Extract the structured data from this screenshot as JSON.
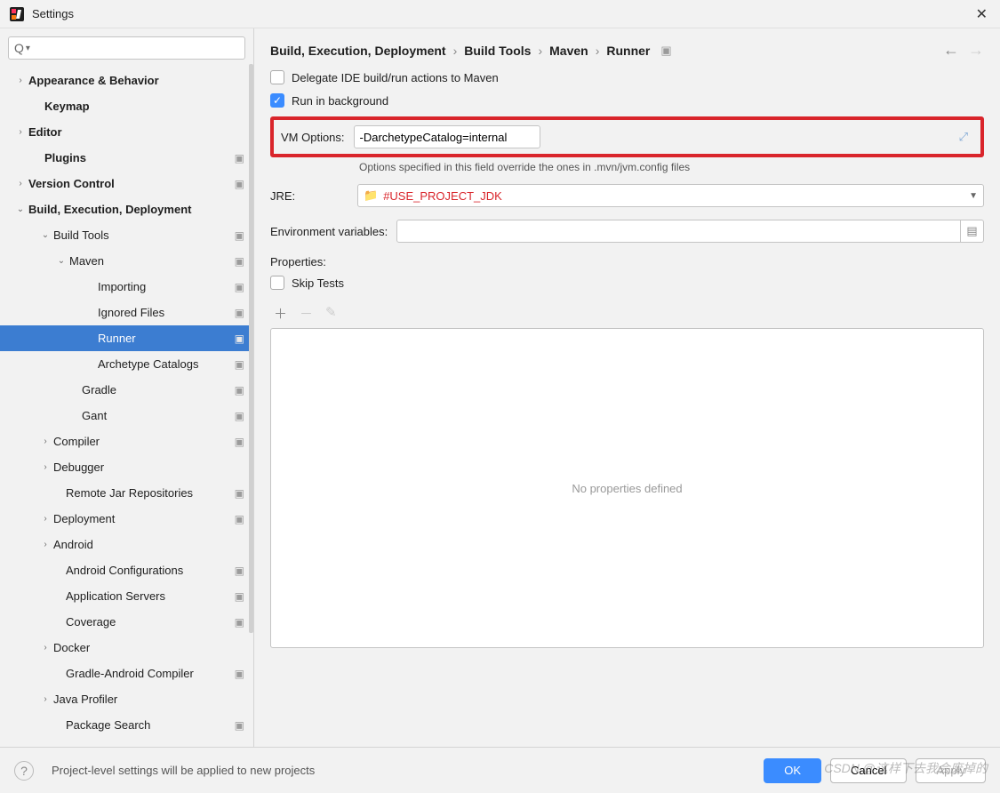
{
  "window": {
    "title": "Settings"
  },
  "sidebar": {
    "search_placeholder": "",
    "items": [
      {
        "label": "Appearance & Behavior",
        "indent": 14,
        "chev": "›",
        "bold": true
      },
      {
        "label": "Keymap",
        "indent": 32,
        "bold": true
      },
      {
        "label": "Editor",
        "indent": 14,
        "chev": "›",
        "bold": true
      },
      {
        "label": "Plugins",
        "indent": 32,
        "bold": true,
        "badge": "▣"
      },
      {
        "label": "Version Control",
        "indent": 14,
        "chev": "›",
        "bold": true,
        "badge": "▣"
      },
      {
        "label": "Build, Execution, Deployment",
        "indent": 14,
        "chev": "⌄",
        "bold": true
      },
      {
        "label": "Build Tools",
        "indent": 42,
        "chev": "⌄",
        "badge": "▣"
      },
      {
        "label": "Maven",
        "indent": 60,
        "chev": "⌄",
        "badge": "▣"
      },
      {
        "label": "Importing",
        "indent": 92,
        "badge": "▣"
      },
      {
        "label": "Ignored Files",
        "indent": 92,
        "badge": "▣"
      },
      {
        "label": "Runner",
        "indent": 92,
        "badge": "▣",
        "selected": true
      },
      {
        "label": "Archetype Catalogs",
        "indent": 92,
        "badge": "▣"
      },
      {
        "label": "Gradle",
        "indent": 74,
        "badge": "▣"
      },
      {
        "label": "Gant",
        "indent": 74,
        "badge": "▣"
      },
      {
        "label": "Compiler",
        "indent": 42,
        "chev": "›",
        "badge": "▣"
      },
      {
        "label": "Debugger",
        "indent": 42,
        "chev": "›"
      },
      {
        "label": "Remote Jar Repositories",
        "indent": 56,
        "badge": "▣"
      },
      {
        "label": "Deployment",
        "indent": 42,
        "chev": "›",
        "badge": "▣"
      },
      {
        "label": "Android",
        "indent": 42,
        "chev": "›"
      },
      {
        "label": "Android Configurations",
        "indent": 56,
        "badge": "▣"
      },
      {
        "label": "Application Servers",
        "indent": 56,
        "badge": "▣"
      },
      {
        "label": "Coverage",
        "indent": 56,
        "badge": "▣"
      },
      {
        "label": "Docker",
        "indent": 42,
        "chev": "›"
      },
      {
        "label": "Gradle-Android Compiler",
        "indent": 56,
        "badge": "▣"
      },
      {
        "label": "Java Profiler",
        "indent": 42,
        "chev": "›"
      },
      {
        "label": "Package Search",
        "indent": 56,
        "badge": "▣"
      }
    ]
  },
  "breadcrumb": {
    "parts": [
      "Build, Execution, Deployment",
      "Build Tools",
      "Maven",
      "Runner"
    ]
  },
  "form": {
    "delegate_label": "Delegate IDE build/run actions to Maven",
    "delegate_checked": false,
    "background_label": "Run in background",
    "background_checked": true,
    "vm_label": "VM Options:",
    "vm_value": "-DarchetypeCatalog=internal",
    "vm_hint": "Options specified in this field override the ones in .mvn/jvm.config files",
    "jre_label": "JRE:",
    "jre_value": "#USE_PROJECT_JDK",
    "env_label": "Environment variables:",
    "env_value": "",
    "properties_label": "Properties:",
    "skip_tests_label": "Skip Tests",
    "skip_tests_checked": false,
    "no_properties": "No properties defined"
  },
  "footer": {
    "message": "Project-level settings will be applied to new projects",
    "ok": "OK",
    "cancel": "Cancel",
    "apply": "Apply"
  },
  "watermark": "CSDN @这样下去我会废掉的"
}
